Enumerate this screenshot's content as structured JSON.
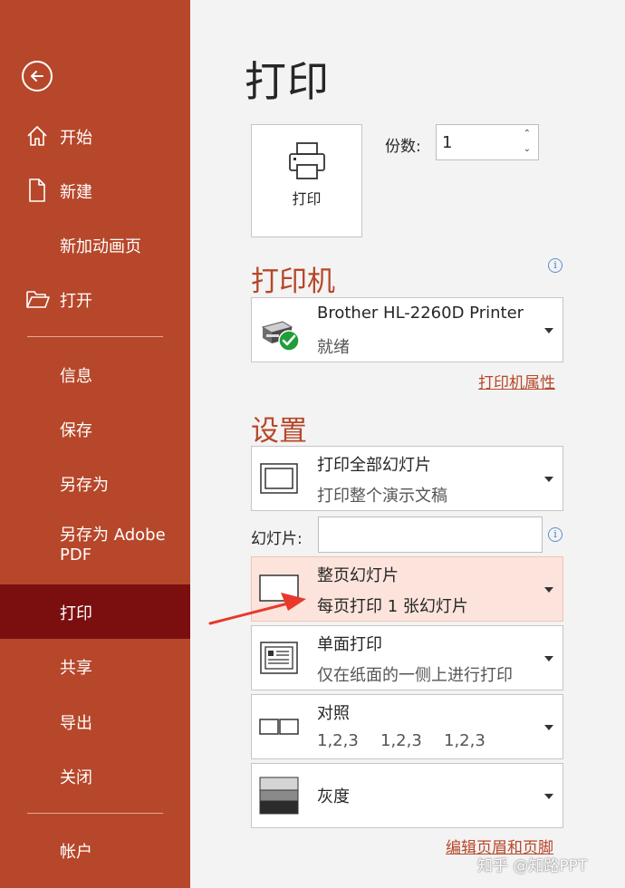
{
  "sidebar": {
    "items": [
      {
        "label": "开始",
        "icon": "home-icon"
      },
      {
        "label": "新建",
        "icon": "new-document-icon"
      },
      {
        "label": "新加动画页",
        "icon": ""
      },
      {
        "label": "打开",
        "icon": "open-folder-icon"
      },
      {
        "label": "信息"
      },
      {
        "label": "保存"
      },
      {
        "label": "另存为"
      },
      {
        "label": "另存为 Adobe PDF"
      },
      {
        "label": "打印",
        "active": true
      },
      {
        "label": "共享"
      },
      {
        "label": "导出"
      },
      {
        "label": "关闭"
      },
      {
        "label": "帐户"
      }
    ]
  },
  "main": {
    "title": "打印",
    "print_button_label": "打印",
    "copies_label": "份数:",
    "copies_value": "1",
    "printer": {
      "section_title": "打印机",
      "name": "Brother HL-2260D Printer",
      "status": "就绪",
      "properties_link": "打印机属性"
    },
    "settings": {
      "section_title": "设置",
      "slides_label": "幻灯片:",
      "slides_value": "",
      "range": {
        "primary": "打印全部幻灯片",
        "secondary": "打印整个演示文稿"
      },
      "layout": {
        "primary": "整页幻灯片",
        "secondary": "每页打印 1 张幻灯片"
      },
      "sides": {
        "primary": "单面打印",
        "secondary": "仅在纸面的一侧上进行打印"
      },
      "collate": {
        "primary": "对照",
        "values": [
          "1,2,3",
          "1,2,3",
          "1,2,3"
        ]
      },
      "color": {
        "primary": "灰度"
      },
      "header_footer_link": "编辑页眉和页脚"
    }
  },
  "watermark": "知乎 @知路PPT",
  "colors": {
    "accent": "#b7472a",
    "sidebar_active": "#7b0f0f",
    "highlight": "#fce4dc",
    "arrow": "#e8392c"
  }
}
